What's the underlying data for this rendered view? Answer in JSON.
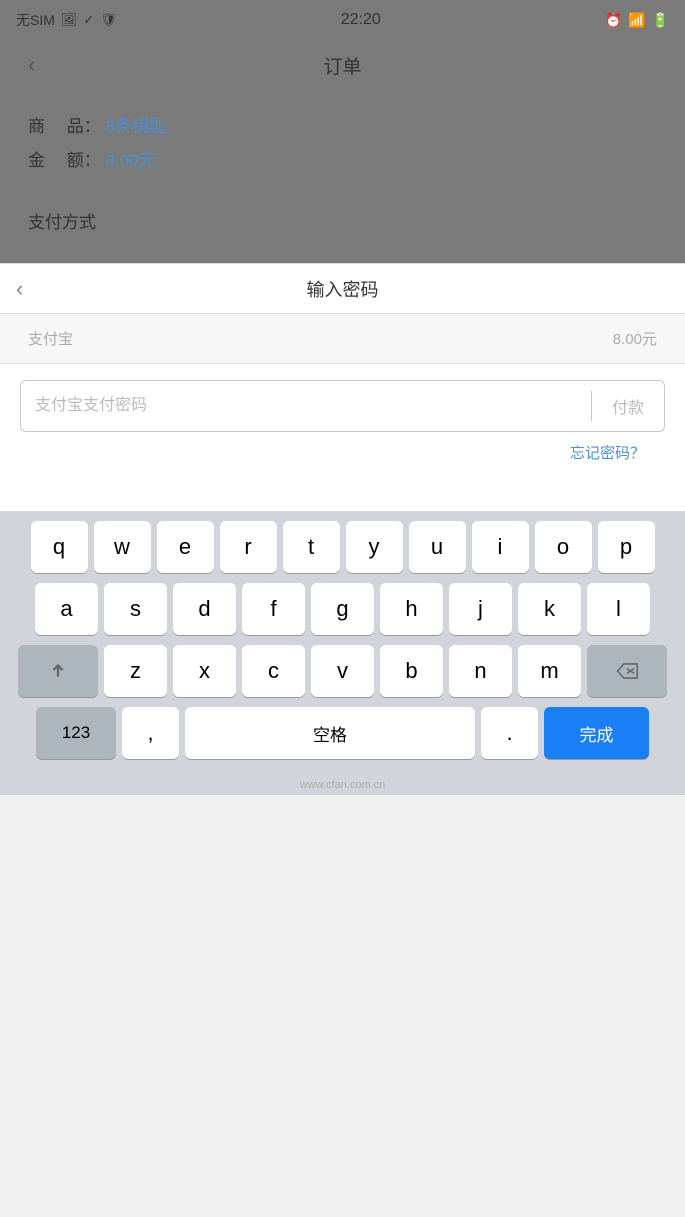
{
  "statusBar": {
    "carrier": "无SIM",
    "time": "22:20"
  },
  "orderPage": {
    "backLabel": "‹",
    "title": "订单",
    "productLabel": "商　 品：",
    "productValue": "8条钥匙",
    "amountLabel": "金　 额：",
    "amountValue": "8.00元",
    "paymentMethodLabel": "支付方式"
  },
  "passwordModal": {
    "backLabel": "‹",
    "title": "输入密码",
    "orderSummaryLeft": "支付宝",
    "orderSummaryRight": "8.00元",
    "passwordPlaceholder": "支付宝支付密码",
    "payButtonLabel": "付款",
    "forgotPasswordLabel": "忘记密码？",
    "amountDisplayLeft": "",
    "amountDisplayRight": ""
  },
  "keyboard": {
    "row1": [
      "q",
      "w",
      "e",
      "r",
      "t",
      "y",
      "u",
      "i",
      "o",
      "p"
    ],
    "row2": [
      "a",
      "s",
      "d",
      "f",
      "g",
      "h",
      "j",
      "k",
      "l"
    ],
    "row3": [
      "z",
      "x",
      "c",
      "v",
      "b",
      "n",
      "m"
    ],
    "shiftLabel": "⇧",
    "deleteLabel": "⌫",
    "numLabel": "123",
    "commaLabel": ",",
    "spaceLabel": "空格",
    "periodLabel": ".",
    "doneLabel": "完成"
  }
}
